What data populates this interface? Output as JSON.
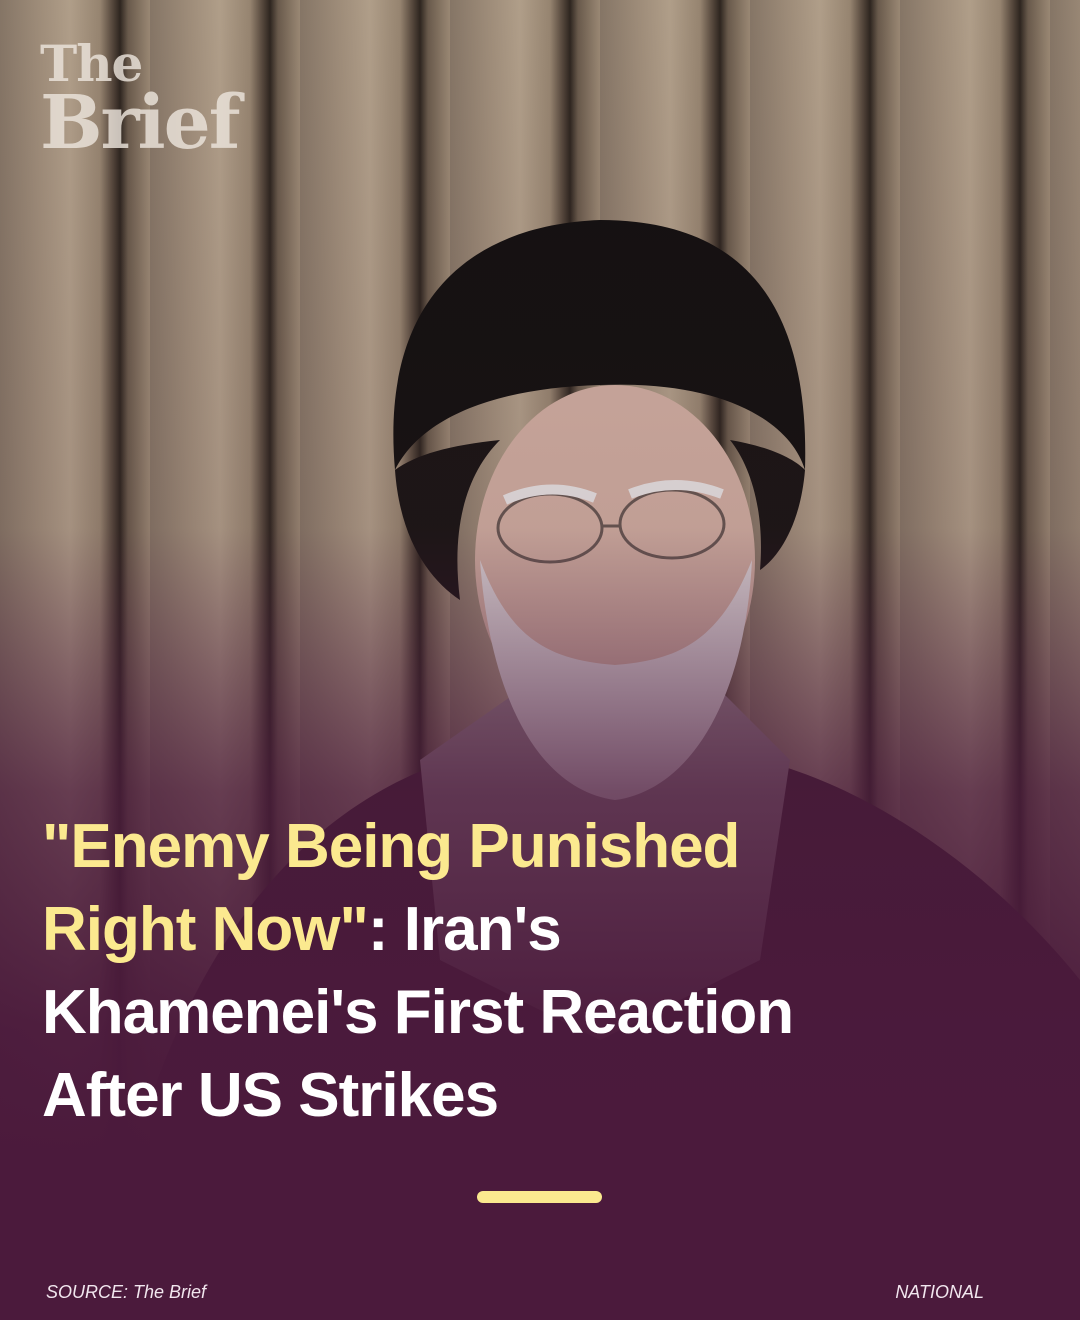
{
  "brand": {
    "logo_line1": "The",
    "logo_line2": "Brief"
  },
  "headline": {
    "highlight": "\"Enemy Being Punished Right Now\"",
    "rest": ": Iran's Khamenei's First Reaction After US Strikes"
  },
  "footer": {
    "source": "SOURCE: The Brief",
    "category": "NATIONAL"
  },
  "colors": {
    "accent": "#fbe98f",
    "background": "#4b1a3c"
  }
}
